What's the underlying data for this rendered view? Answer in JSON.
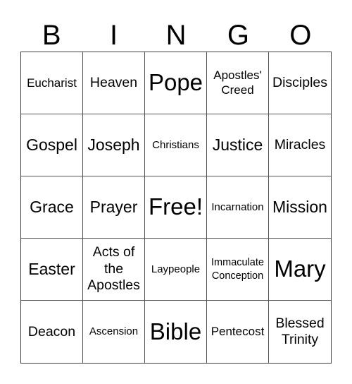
{
  "header": {
    "letters": [
      "B",
      "I",
      "N",
      "G",
      "O"
    ]
  },
  "board": {
    "cells": [
      [
        "Eucharist",
        "Heaven",
        "Pope",
        "Apostles' Creed",
        "Disciples"
      ],
      [
        "Gospel",
        "Joseph",
        "Christians",
        "Justice",
        "Miracles"
      ],
      [
        "Grace",
        "Prayer",
        "Free!",
        "Incarnation",
        "Mission"
      ],
      [
        "Easter",
        "Acts of the Apostles",
        "Laypeople",
        "Immaculate Conception",
        "Mary"
      ],
      [
        "Deacon",
        "Ascension",
        "Bible",
        "Pentecost",
        "Blessed Trinity"
      ]
    ],
    "free_space": "Free!",
    "colors": {
      "text": "#000000",
      "grid_line": "#555555",
      "background": "#ffffff"
    }
  }
}
